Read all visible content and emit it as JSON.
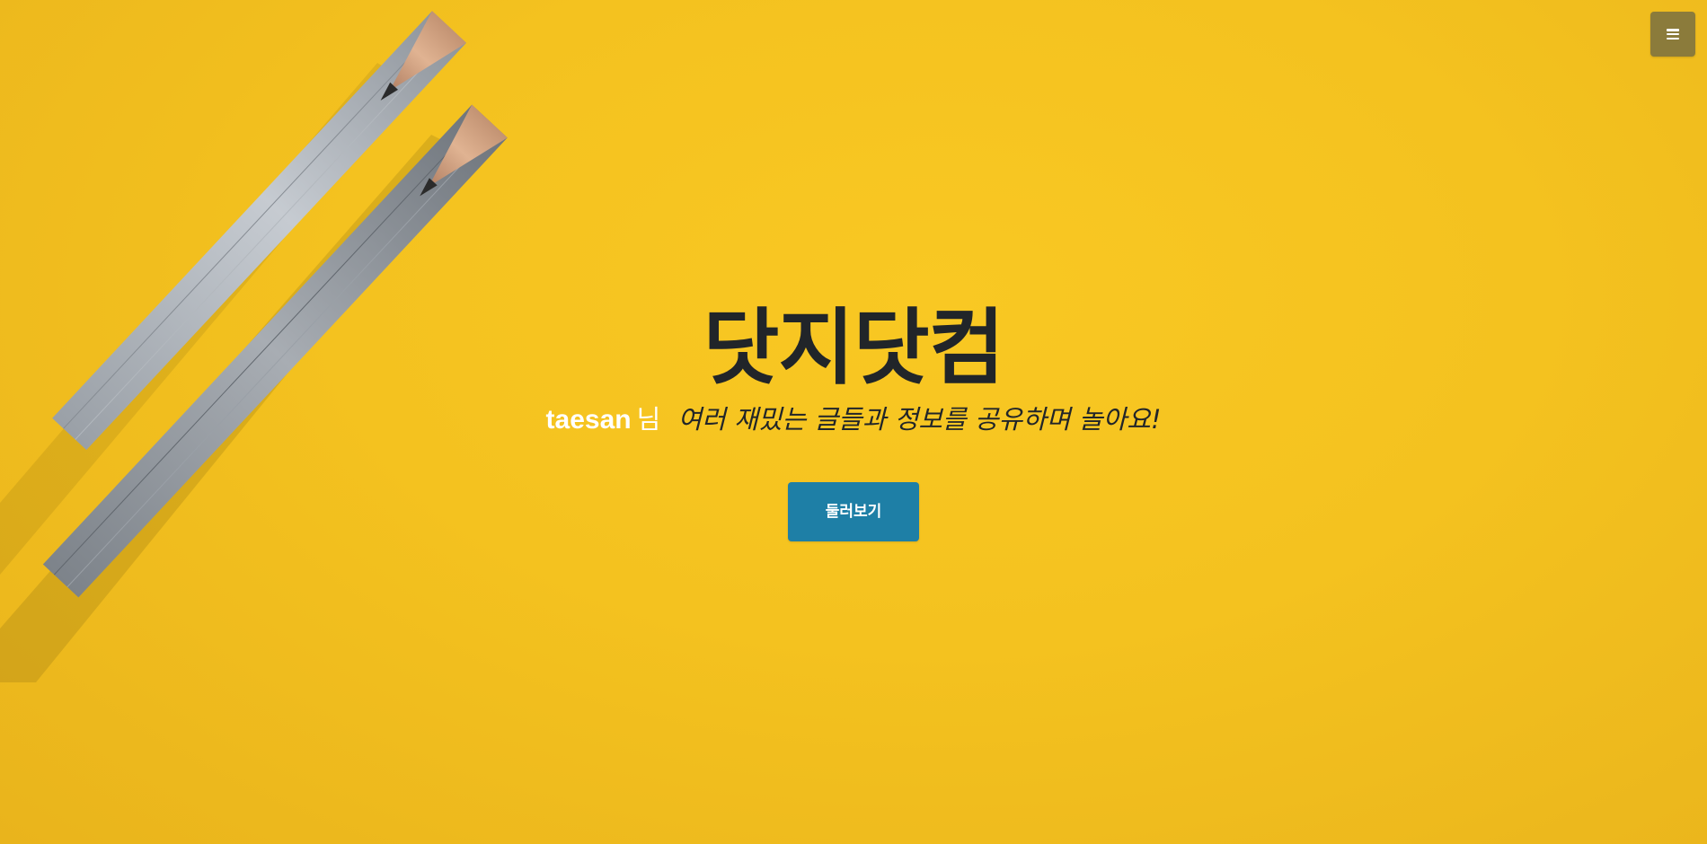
{
  "background": {
    "accent_color": "#f6c420",
    "image_subject": "two gray pencils on yellow paper"
  },
  "nav": {
    "menu_icon": "hamburger-menu-icon",
    "menu_button_color": "#8b7b3b"
  },
  "hero": {
    "title": "닷지닷컴",
    "username": "taesan",
    "honorific": "님",
    "message": "여러 재밌는 글들과 정보를 공유하며 놀아요!",
    "button_label": "둘러보기",
    "button_color": "#1e7fa6",
    "title_color": "#212529"
  }
}
